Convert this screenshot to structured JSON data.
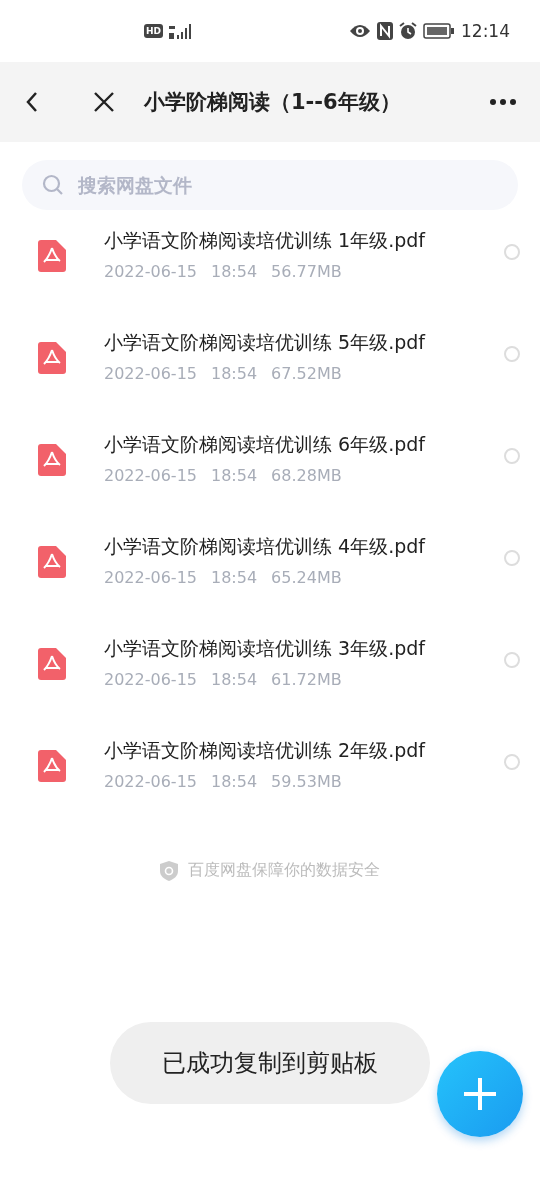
{
  "status_bar": {
    "network": "HD",
    "time": "12:14"
  },
  "header": {
    "title": "小学阶梯阅读（1--6年级）"
  },
  "search": {
    "placeholder": "搜索网盘文件"
  },
  "files": [
    {
      "name": "小学语文阶梯阅读培优训练 1年级.pdf",
      "date": "2022-06-15",
      "time": "18:54",
      "size": "56.77MB",
      "selected": false
    },
    {
      "name": "小学语文阶梯阅读培优训练 5年级.pdf",
      "date": "2022-06-15",
      "time": "18:54",
      "size": "67.52MB",
      "selected": false
    },
    {
      "name": "小学语文阶梯阅读培优训练 6年级.pdf",
      "date": "2022-06-15",
      "time": "18:54",
      "size": "68.28MB",
      "selected": false
    },
    {
      "name": "小学语文阶梯阅读培优训练 4年级.pdf",
      "date": "2022-06-15",
      "time": "18:54",
      "size": "65.24MB",
      "selected": false
    },
    {
      "name": "小学语文阶梯阅读培优训练 3年级.pdf",
      "date": "2022-06-15",
      "time": "18:54",
      "size": "61.72MB",
      "selected": false
    },
    {
      "name": "小学语文阶梯阅读培优训练 2年级.pdf",
      "date": "2022-06-15",
      "time": "18:54",
      "size": "59.53MB",
      "selected": false
    }
  ],
  "footer": {
    "text": "百度网盘保障你的数据安全"
  },
  "toast": {
    "text": "已成功复制到剪贴板"
  }
}
